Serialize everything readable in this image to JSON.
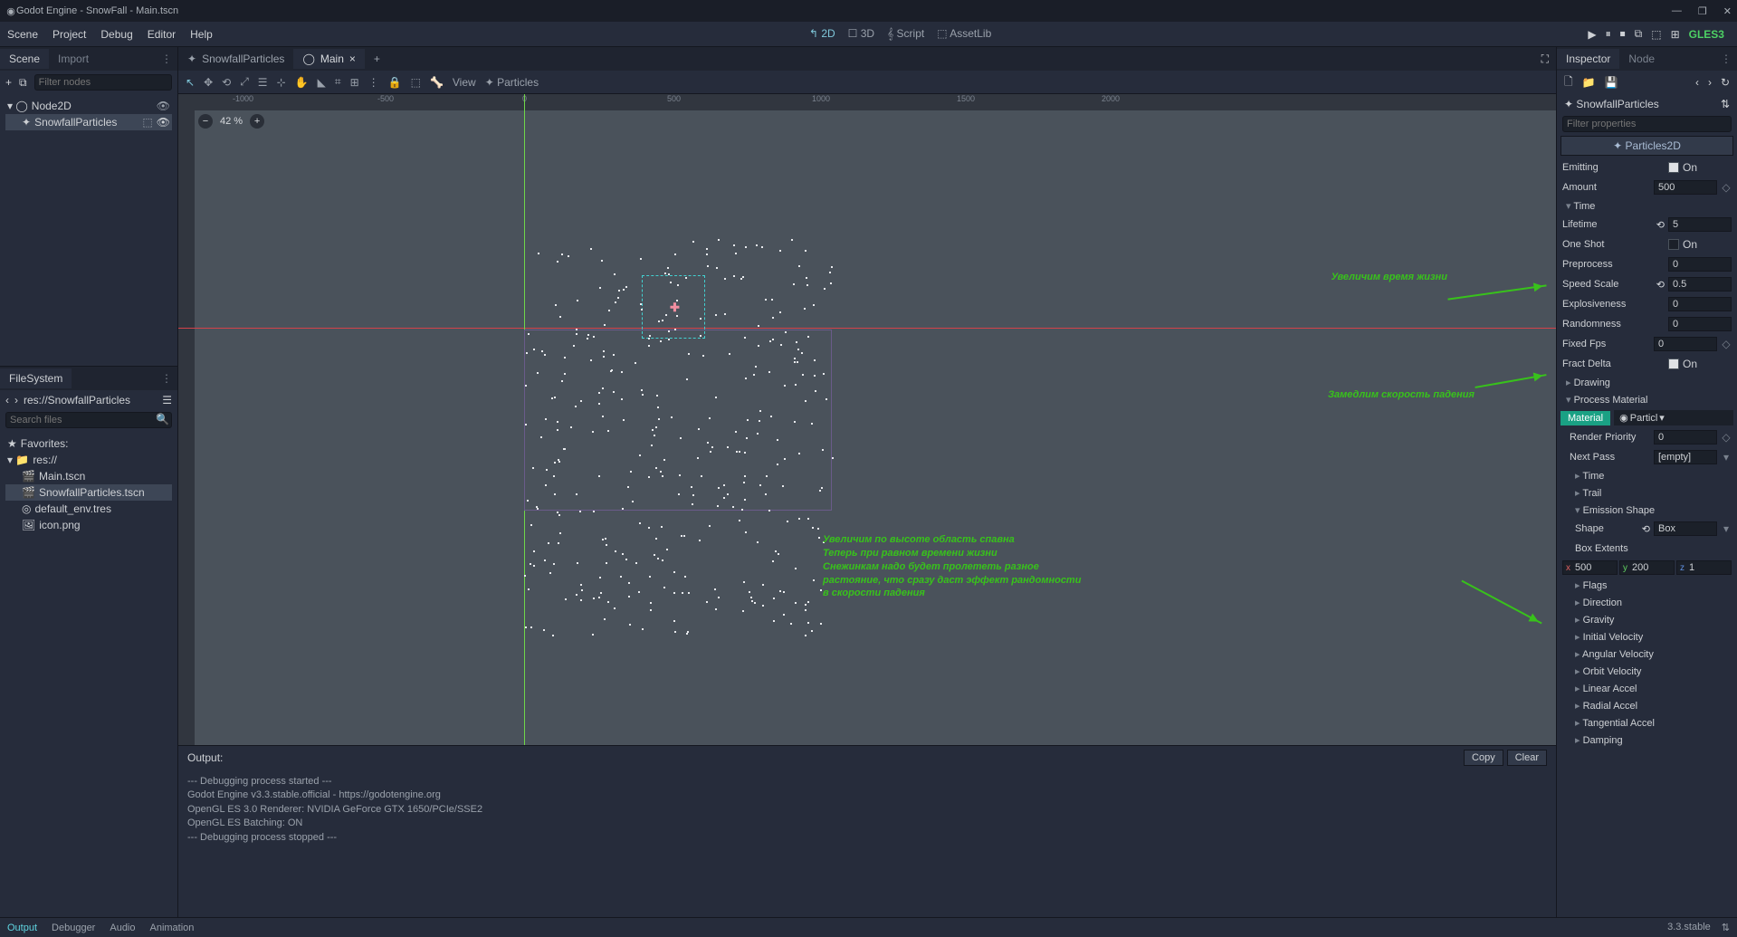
{
  "title": "Godot Engine - SnowFall - Main.tscn",
  "menu": [
    "Scene",
    "Project",
    "Debug",
    "Editor",
    "Help"
  ],
  "workspaces": {
    "d2": "2D",
    "d3": "3D",
    "script": "Script",
    "assetlib": "AssetLib"
  },
  "renderer": "GLES3",
  "scene_dock": {
    "tab_scene": "Scene",
    "tab_import": "Import",
    "filter_ph": "Filter nodes",
    "root": "Node2D",
    "child": "SnowfallParticles"
  },
  "scene_tabs": {
    "t1": "SnowfallParticles",
    "t2": "Main"
  },
  "view_menu": "View",
  "particles_menu": "Particles",
  "zoom": "42 %",
  "rulers": [
    "-1000",
    "-500",
    "0",
    "500",
    "1000",
    "1500",
    "2000"
  ],
  "annotations": {
    "a1": "Увеличим время жизни",
    "a2": "Замедлим скорость падения",
    "a3_l1": "Увеличим по высоте область спавна",
    "a3_l2": "Теперь при равном времени жизни",
    "a3_l3": "Снежинкам надо будет пролететь разное",
    "a3_l4": " растояние, что сразу даст эффект рандомности",
    "a3_l5": "в скорости падения"
  },
  "filesystem": {
    "title": "FileSystem",
    "path": "res://SnowfallParticles",
    "search_ph": "Search files",
    "fav": "Favorites:",
    "root": "res://",
    "files": [
      "Main.tscn",
      "SnowfallParticles.tscn",
      "default_env.tres",
      "icon.png"
    ]
  },
  "output": {
    "title": "Output:",
    "copy": "Copy",
    "clear": "Clear",
    "lines": [
      "--- Debugging process started ---",
      "Godot Engine v3.3.stable.official - https://godotengine.org",
      "OpenGL ES 3.0 Renderer: NVIDIA GeForce GTX 1650/PCIe/SSE2",
      "OpenGL ES Batching: ON",
      "",
      "--- Debugging process stopped ---"
    ]
  },
  "bottom_tabs": [
    "Output",
    "Debugger",
    "Audio",
    "Animation"
  ],
  "version": "3.3.stable",
  "inspector": {
    "tab_insp": "Inspector",
    "tab_node": "Node",
    "crumb": "SnowfallParticles",
    "filter_ph": "Filter properties",
    "class": "Particles2D",
    "emitting": {
      "label": "Emitting",
      "on": "On"
    },
    "amount": {
      "label": "Amount",
      "val": "500"
    },
    "time_group": "Time",
    "lifetime": {
      "label": "Lifetime",
      "val": "5"
    },
    "oneshot": {
      "label": "One Shot",
      "on": "On"
    },
    "preprocess": {
      "label": "Preprocess",
      "val": "0"
    },
    "speed": {
      "label": "Speed Scale",
      "val": "0.5"
    },
    "explosive": {
      "label": "Explosiveness",
      "val": "0"
    },
    "random": {
      "label": "Randomness",
      "val": "0"
    },
    "fixedfps": {
      "label": "Fixed Fps",
      "val": "0"
    },
    "fract": {
      "label": "Fract Delta",
      "on": "On"
    },
    "drawing": "Drawing",
    "pmat_group": "Process Material",
    "material": {
      "label": "Material",
      "val": "Particl"
    },
    "render_pri": {
      "label": "Render Priority",
      "val": "0"
    },
    "next_pass": {
      "label": "Next Pass",
      "val": "[empty]"
    },
    "sub": [
      "Time",
      "Trail"
    ],
    "emshape_group": "Emission Shape",
    "shape": {
      "label": "Shape",
      "val": "Box"
    },
    "box_extents": "Box Extents",
    "box": {
      "x": "500",
      "y": "200",
      "z": "1"
    },
    "rest": [
      "Flags",
      "Direction",
      "Gravity",
      "Initial Velocity",
      "Angular Velocity",
      "Orbit Velocity",
      "Linear Accel",
      "Radial Accel",
      "Tangential Accel",
      "Damping"
    ]
  }
}
